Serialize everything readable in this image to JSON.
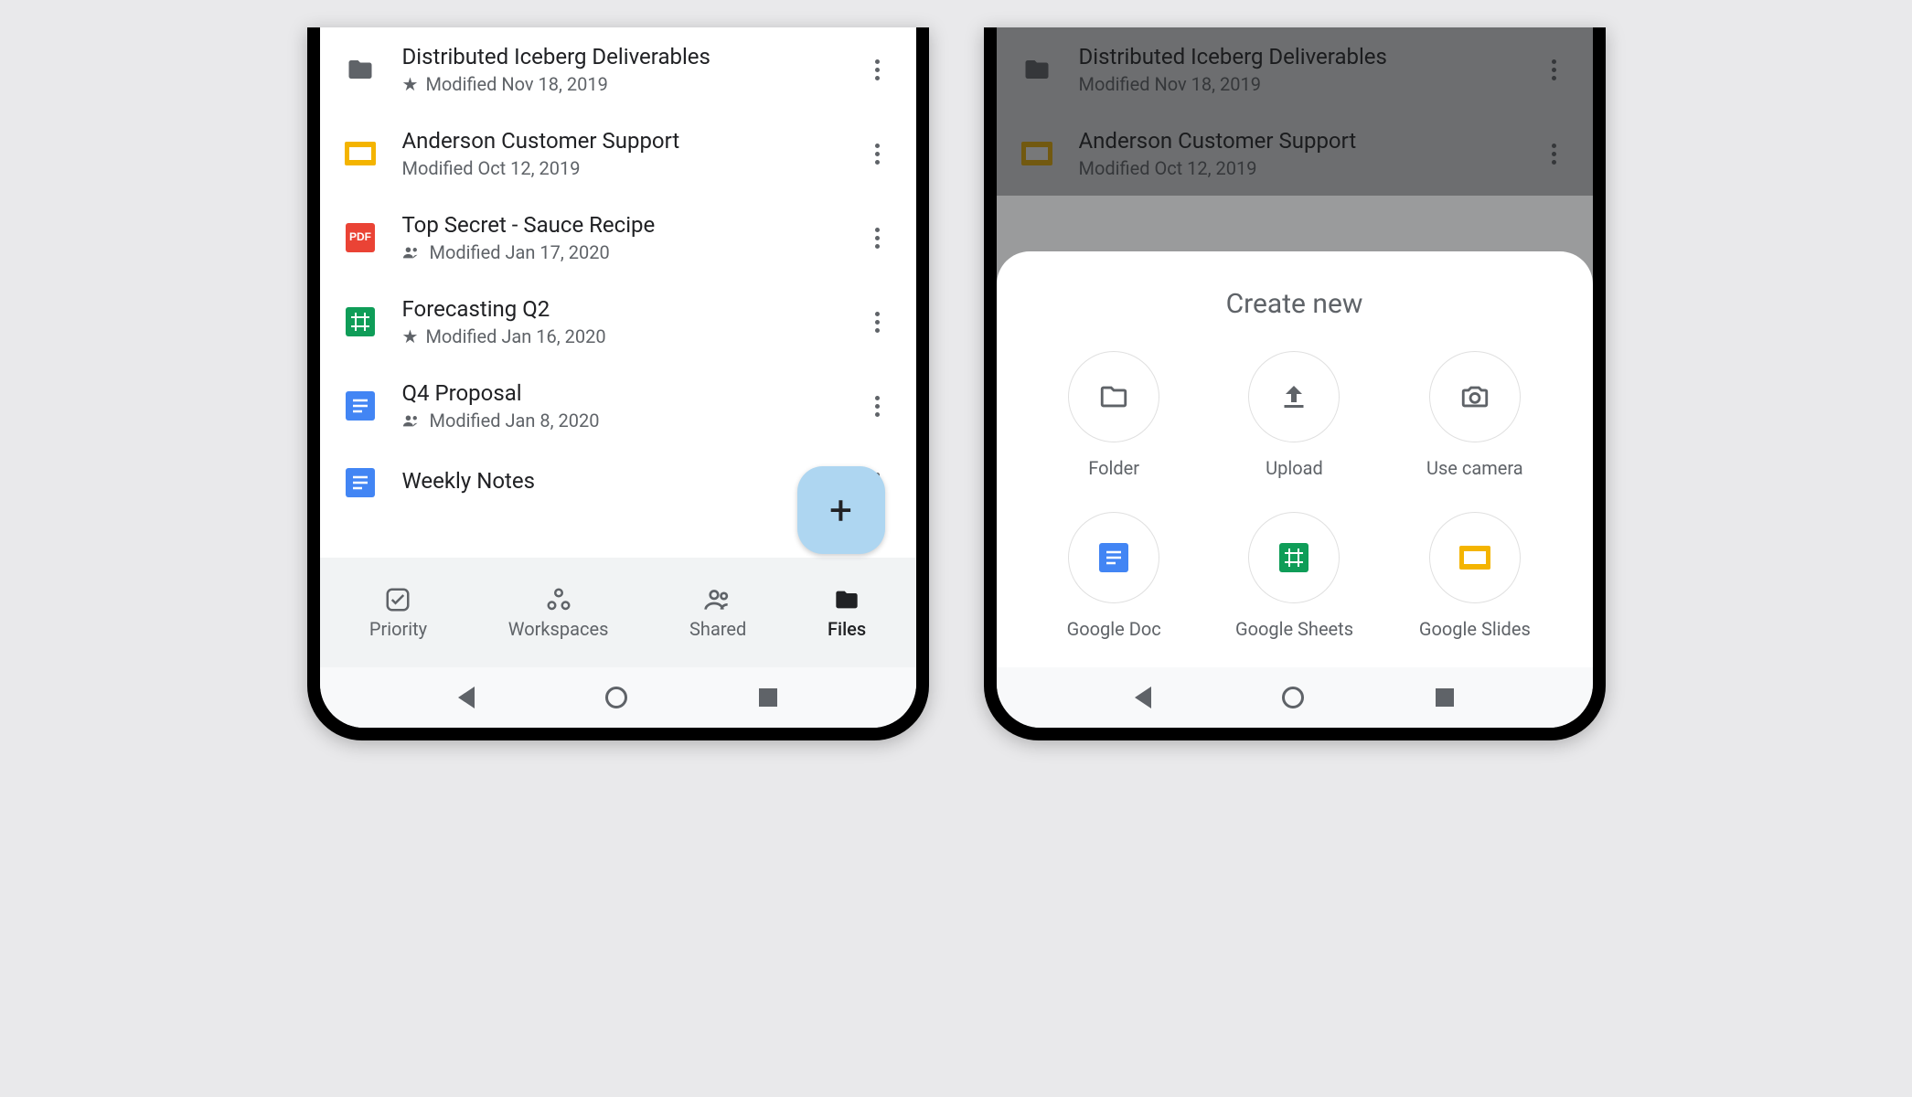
{
  "phone1": {
    "files": [
      {
        "title": "Distributed Iceberg Deliverables",
        "sub": "Modified Nov 18, 2019",
        "starred": true,
        "shared": false,
        "icon": "folder-dark"
      },
      {
        "title": "Anderson Customer Support",
        "sub": "Modified Oct 12, 2019",
        "starred": false,
        "shared": false,
        "icon": "slides"
      },
      {
        "title": "Top Secret - Sauce Recipe",
        "sub": "Modified Jan 17, 2020",
        "starred": false,
        "shared": true,
        "icon": "pdf"
      },
      {
        "title": "Forecasting Q2",
        "sub": "Modified Jan 16, 2020",
        "starred": true,
        "shared": false,
        "icon": "sheets"
      },
      {
        "title": "Q4 Proposal",
        "sub": "Modified Jan 8, 2020",
        "starred": false,
        "shared": true,
        "icon": "docs"
      },
      {
        "title": "Weekly Notes",
        "sub": "",
        "starred": false,
        "shared": false,
        "icon": "docs"
      }
    ],
    "nav": [
      {
        "label": "Priority",
        "icon": "priority",
        "active": false
      },
      {
        "label": "Workspaces",
        "icon": "workspaces",
        "active": false
      },
      {
        "label": "Shared",
        "icon": "shared",
        "active": false
      },
      {
        "label": "Files",
        "icon": "files",
        "active": true
      }
    ]
  },
  "phone2": {
    "dimmed_files": [
      {
        "title": "Distributed Iceberg Deliverables",
        "sub": "Modified Nov 18, 2019",
        "icon": "folder-dark"
      },
      {
        "title": "Anderson Customer Support",
        "sub": "Modified Oct 12, 2019",
        "icon": "slides"
      }
    ],
    "sheet": {
      "title": "Create new",
      "items": [
        {
          "label": "Folder",
          "icon": "folder-outline"
        },
        {
          "label": "Upload",
          "icon": "upload"
        },
        {
          "label": "Use camera",
          "icon": "camera"
        },
        {
          "label": "Google Doc",
          "icon": "docs"
        },
        {
          "label": "Google Sheets",
          "icon": "sheets"
        },
        {
          "label": "Google Slides",
          "icon": "slides"
        }
      ]
    }
  }
}
